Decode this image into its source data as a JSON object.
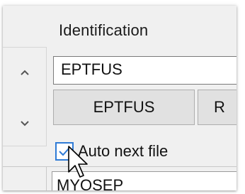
{
  "section": {
    "label": "Identification"
  },
  "identification": {
    "value": "EPTFUS"
  },
  "buttons": [
    {
      "label": "EPTFUS"
    },
    {
      "label": "R"
    }
  ],
  "scroll": {
    "up_icon": "chevron-up-icon",
    "down_icon": "chevron-down-icon"
  },
  "auto_next": {
    "checked": true,
    "label": "Auto next file"
  },
  "bottom": {
    "value": "MYOSEP"
  },
  "colors": {
    "checkbox_border": "#2f7bd6",
    "panel_bg": "#f0f0f0",
    "button_bg": "#e1e1e1"
  }
}
